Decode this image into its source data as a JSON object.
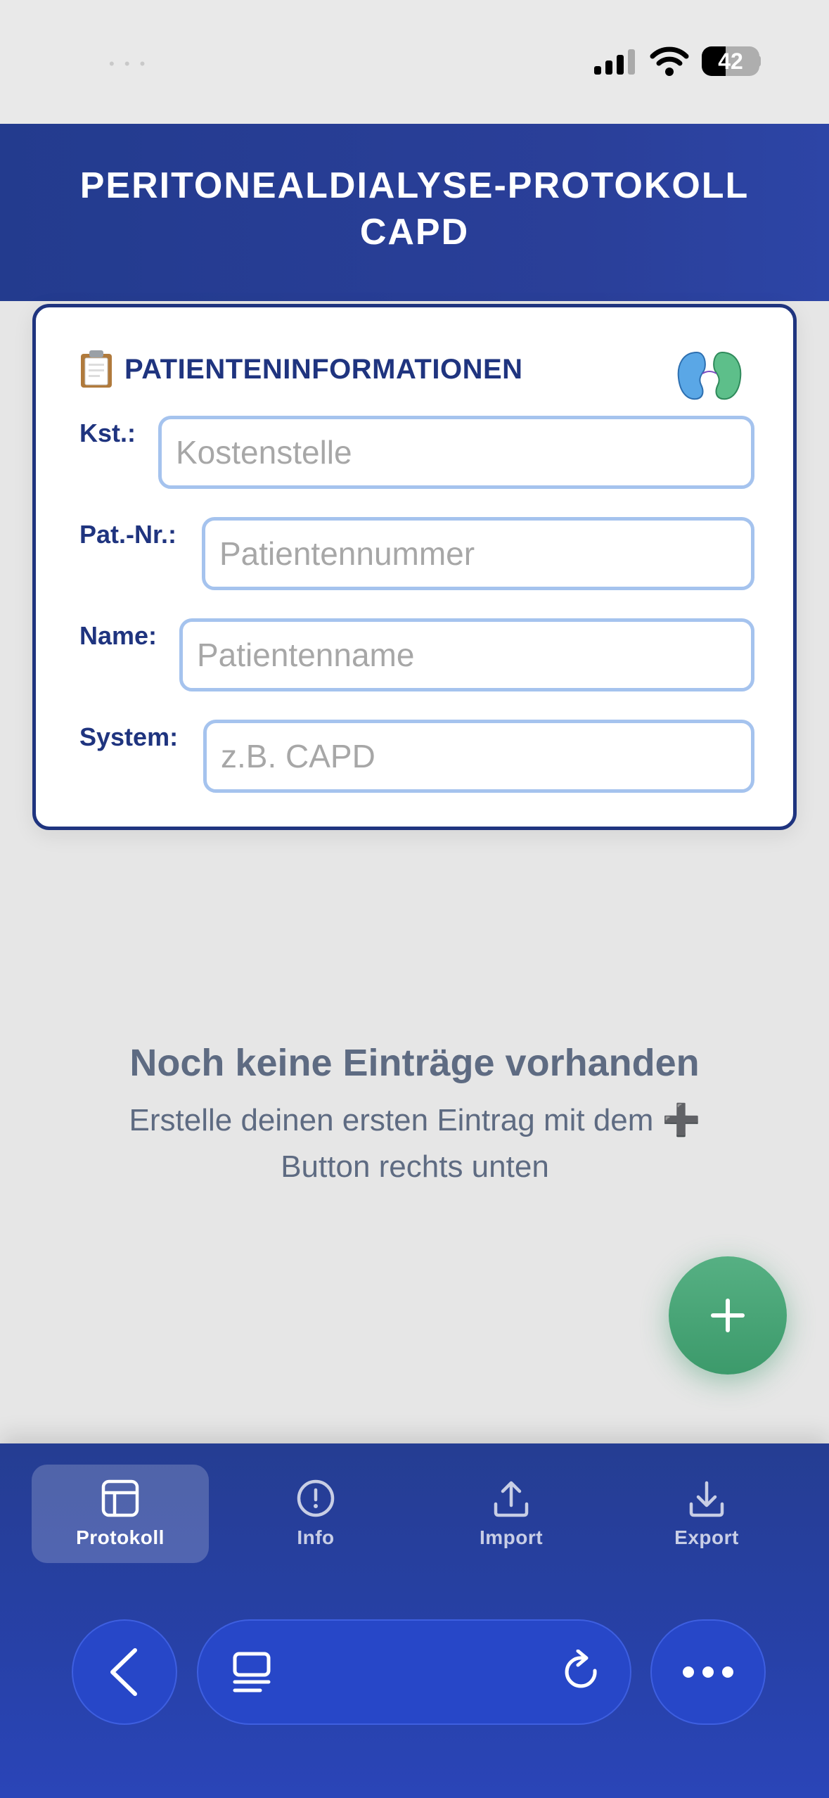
{
  "status_bar": {
    "battery_level": "42"
  },
  "header": {
    "title": "PERITONEALDIALYSE-PROTOKOLL CAPD"
  },
  "patient_card": {
    "title": "PATIENTENINFORMATIONEN",
    "fields": [
      {
        "label": "Kst.:",
        "placeholder": "Kostenstelle",
        "value": ""
      },
      {
        "label": "Pat.-Nr.:",
        "placeholder": "Patientennummer",
        "value": ""
      },
      {
        "label": "Name:",
        "placeholder": "Patientenname",
        "value": ""
      },
      {
        "label": "System:",
        "placeholder": "z.B. CAPD",
        "value": ""
      }
    ]
  },
  "empty_state": {
    "title": "Noch keine Einträge vorhanden",
    "text_before": "Erstelle deinen ersten Eintrag mit dem",
    "plus_symbol": "➕",
    "text_after": "Button rechts unten"
  },
  "tabs": [
    {
      "label": "Protokoll",
      "icon": "table-icon",
      "active": true
    },
    {
      "label": "Info",
      "icon": "info-icon",
      "active": false
    },
    {
      "label": "Import",
      "icon": "upload-icon",
      "active": false
    },
    {
      "label": "Export",
      "icon": "download-icon",
      "active": false
    }
  ],
  "colors": {
    "primary": "#233b8e",
    "accent_green": "#3c9a6b",
    "input_border": "#a5c3ee",
    "browser_bar": "#2747c8"
  }
}
